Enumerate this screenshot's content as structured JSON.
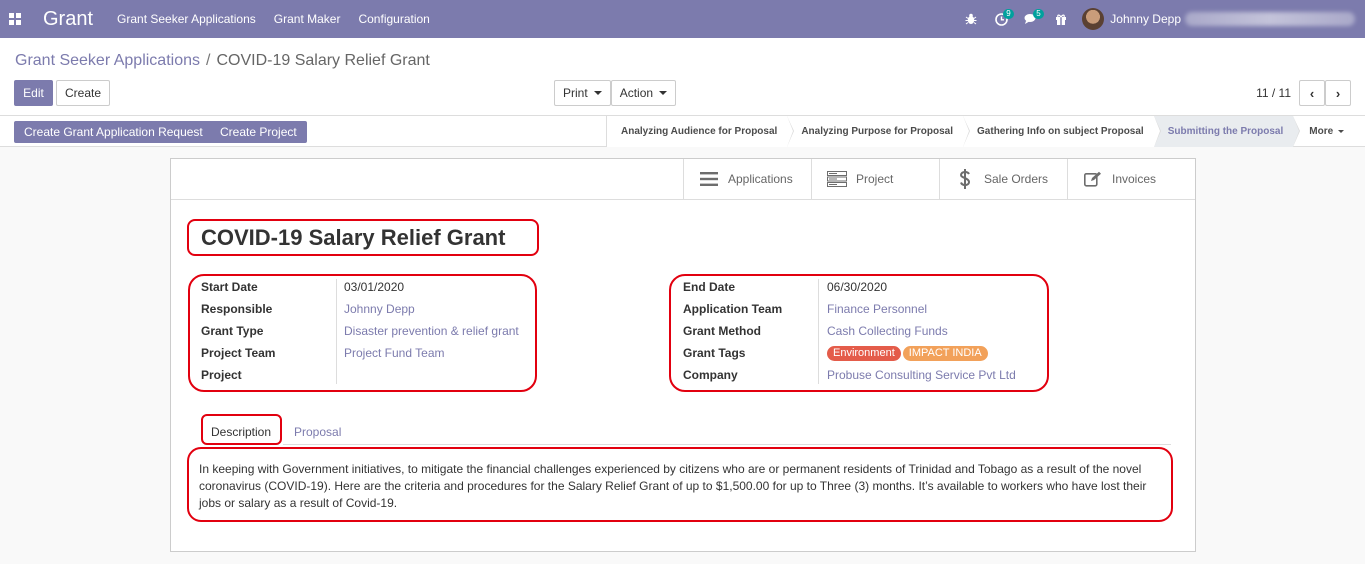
{
  "navbar": {
    "brand": "Grant",
    "menus": [
      "Grant Seeker Applications",
      "Grant Maker",
      "Configuration"
    ],
    "activity_count": "9",
    "messages_count": "5",
    "user_name": "Johnny Depp"
  },
  "breadcrumb": {
    "parent": "Grant Seeker Applications",
    "separator": "/",
    "current": "COVID-19 Salary Relief Grant"
  },
  "buttons": {
    "edit": "Edit",
    "create": "Create",
    "print": "Print",
    "action": "Action"
  },
  "pager": {
    "value": "11 / 11",
    "prev": "‹",
    "next": "›"
  },
  "header_buttons": [
    "Create Grant Application Request",
    "Create Project"
  ],
  "stages": [
    "Analyzing Audience for Proposal",
    "Analyzing Purpose for Proposal",
    "Gathering Info on subject Proposal",
    "Submitting the Proposal"
  ],
  "active_stage_index": 3,
  "stage_more": "More",
  "smart_buttons": [
    "Applications",
    "Project",
    "Sale Orders",
    "Invoices"
  ],
  "record": {
    "title": "COVID-19 Salary Relief Grant",
    "left_fields": [
      {
        "label": "Start Date",
        "value": "03/01/2020"
      },
      {
        "label": "Responsible",
        "value": "Johnny Depp"
      },
      {
        "label": "Grant Type",
        "value": "Disaster prevention & relief grant"
      },
      {
        "label": "Project Team",
        "value": "Project Fund Team"
      },
      {
        "label": "Project",
        "value": ""
      }
    ],
    "right_fields": [
      {
        "label": "End Date",
        "value": "06/30/2020"
      },
      {
        "label": "Application Team",
        "value": "Finance Personnel"
      },
      {
        "label": "Grant Method",
        "value": "Cash Collecting Funds"
      },
      {
        "label": "Grant Tags",
        "value": ""
      },
      {
        "label": "Company",
        "value": "Probuse Consulting Service Pvt Ltd"
      }
    ],
    "tags": [
      "Environment",
      "IMPACT INDIA"
    ]
  },
  "tabs": [
    "Description",
    "Proposal"
  ],
  "description": "In keeping with Government initiatives, to mitigate the financial challenges experienced by citizens who are or permanent residents of Trinidad and Tobago as a result of the novel coronavirus (COVID-19). Here are the criteria and procedures for the Salary Relief Grant of up to $1,500.00 for up to Three (3) months. It’s available to workers who have lost their jobs or salary as a result of Covid-19.",
  "colors": {
    "brand": "#7c7bad",
    "highlight": "#e2000f",
    "tag_environment": "#e45c4a",
    "tag_impact": "#f2a15a",
    "badge": "#00a09d"
  }
}
